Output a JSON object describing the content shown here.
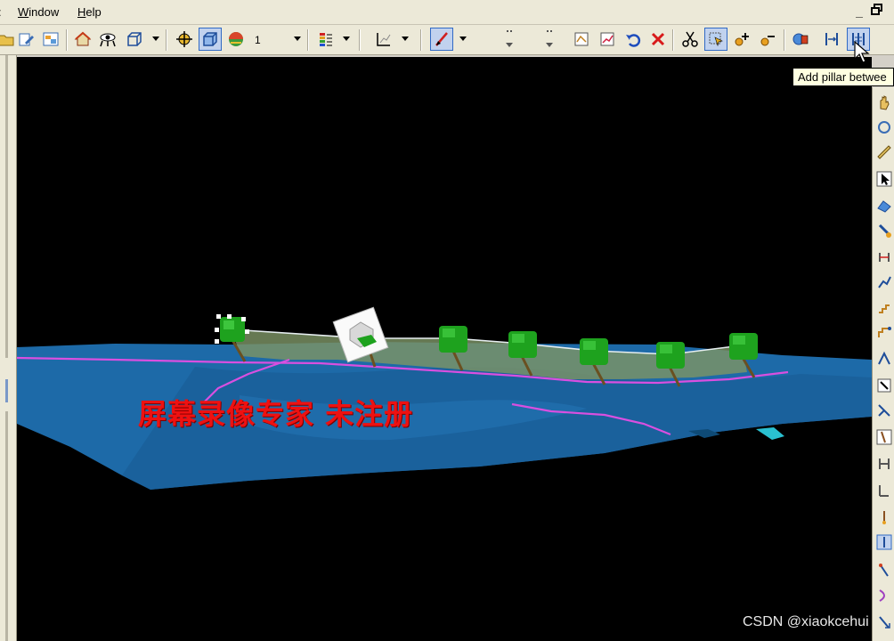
{
  "menubar": {
    "items": [
      {
        "label": "Window",
        "mnemonic": "W"
      },
      {
        "label": "Help",
        "mnemonic": "H"
      }
    ],
    "minimize_glyph": "_"
  },
  "toolbar": {
    "layer_combo_value": "1",
    "icons": [
      "folder-open-icon",
      "edit-file-icon",
      "layers-window-icon",
      "home-icon",
      "view-eye-icon",
      "wireframe-cube-icon",
      "target-crosshair-icon",
      "3d-view-icon",
      "shaded-sphere-icon",
      "color-legend-icon",
      "axis-icon",
      "pen-stroke-icon",
      "edit-surface-icon",
      "chart-edit-icon",
      "undo-icon",
      "delete-icon",
      "cut-icon",
      "select-tool-icon",
      "add-point-icon",
      "remove-point-icon",
      "fly-view-icon",
      "add-pillar-icon",
      "add-pillar-between-icon"
    ]
  },
  "tooltip": {
    "text": "Add pillar betwee"
  },
  "viewport": {
    "watermark": "屏幕录像专家 未注册",
    "credit": "CSDN @xiaokcehui"
  },
  "colors": {
    "viewport_bg": "#000000",
    "surface_blue": "#1d6aa8",
    "fault_line": "#d94fe0",
    "pillar_green": "#1ea21e",
    "fault_plane": "#6e8f5a",
    "watermark_red": "#ee1111"
  }
}
